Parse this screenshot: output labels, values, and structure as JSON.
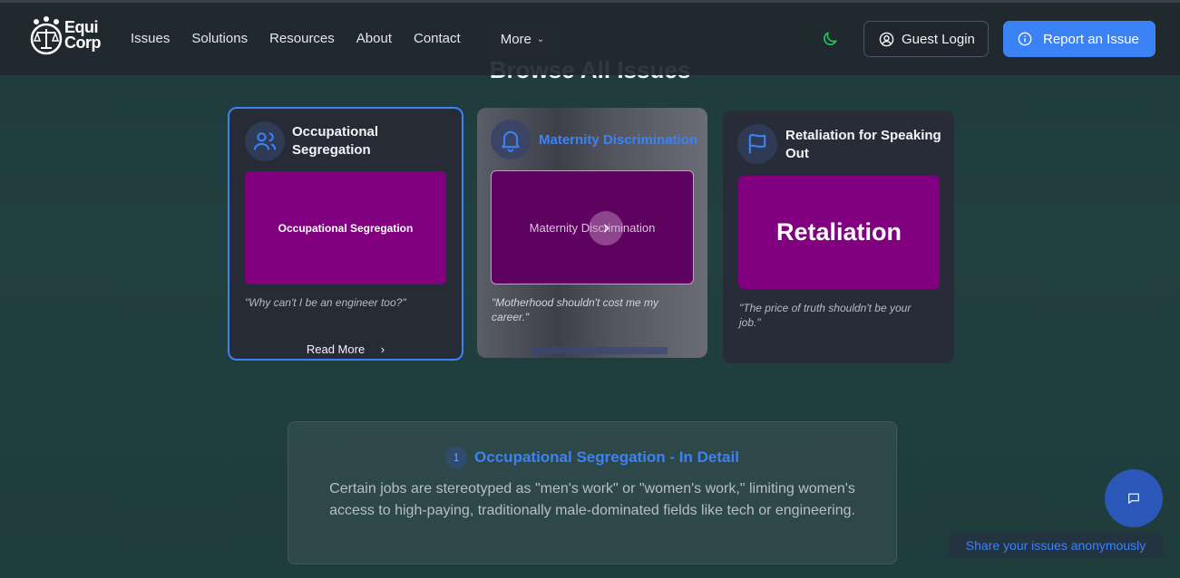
{
  "section_title": "Browse All Issues",
  "brand": {
    "line1": "Equi",
    "line2": "Corp"
  },
  "nav": {
    "links": [
      "Issues",
      "Solutions",
      "Resources",
      "About",
      "Contact"
    ],
    "more_label": "More",
    "guest_login_label": "Guest Login",
    "report_label": "Report an Issue"
  },
  "cards": [
    {
      "title_line1": "Occupational",
      "title_line2": "Segregation",
      "image_text": "Occupational Segregation",
      "quote": "\"Why can't I be an engineer too?\"",
      "read_more": "Read More",
      "icon": "users-icon"
    },
    {
      "title": "Maternity Discrimination",
      "image_text": "Maternity Discrimination",
      "quote_line1": "\"Motherhood shouldn't cost me my",
      "quote_line2": "career.\"",
      "icon": "bell-icon"
    },
    {
      "title_line1": "Retaliation for Speaking",
      "title_line2": "Out",
      "image_text": "Retaliation",
      "quote_line1": "\"The price of truth shouldn't be your",
      "quote_line2": "job.\"",
      "icon": "flag-icon"
    }
  ],
  "detail": {
    "number": "1",
    "title": "Occupational Segregation - In Detail",
    "text": "Certain jobs are stereotyped as \"men's work\" or \"women's work,\" limiting women's access to high-paying, traditionally male-dominated fields like tech or engineering."
  },
  "chat": {
    "tooltip": "Share your issues anonymously"
  },
  "colors": {
    "accent": "#3b82f6",
    "card_image": "#800080",
    "moon": "#22c55e"
  }
}
